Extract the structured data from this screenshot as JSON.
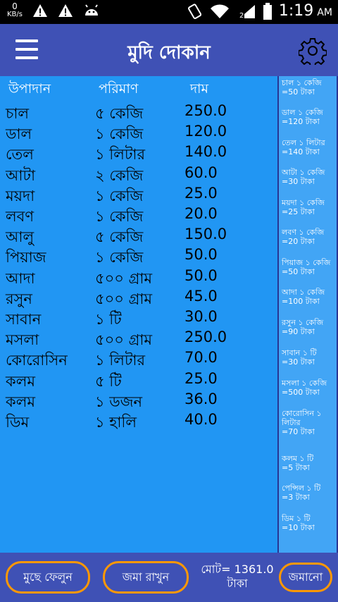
{
  "status_bar": {
    "speed_value": "0",
    "speed_unit": "KB/s",
    "time": "1:19",
    "ampm": "AM"
  },
  "app_bar": {
    "title": "মুদি দোকান"
  },
  "table": {
    "headers": {
      "item": "উপাদান",
      "quantity": "পরিমাণ",
      "price": "দাম"
    },
    "rows": [
      {
        "item": "চাল",
        "quantity": "৫ কেজি",
        "price": "250.0"
      },
      {
        "item": "ডাল",
        "quantity": "১ কেজি",
        "price": "120.0"
      },
      {
        "item": "তেল",
        "quantity": "১ লিটার",
        "price": "140.0"
      },
      {
        "item": "আটা",
        "quantity": "২ কেজি",
        "price": "60.0"
      },
      {
        "item": "ময়দা",
        "quantity": "১ কেজি",
        "price": "25.0"
      },
      {
        "item": "লবণ",
        "quantity": "১ কেজি",
        "price": "20.0"
      },
      {
        "item": "আলু",
        "quantity": "৫ কেজি",
        "price": "150.0"
      },
      {
        "item": "পিয়াজ",
        "quantity": "১ কেজি",
        "price": "50.0"
      },
      {
        "item": "আদা",
        "quantity": "৫০০ গ্রাম",
        "price": "50.0"
      },
      {
        "item": "রসুন",
        "quantity": "৫০০ গ্রাম",
        "price": "45.0"
      },
      {
        "item": "সাবান",
        "quantity": "১ টি",
        "price": "30.0"
      },
      {
        "item": "মসলা",
        "quantity": "৫০০ গ্রাম",
        "price": "250.0"
      },
      {
        "item": "কোরোসিন",
        "quantity": "১ লিটার",
        "price": "70.0"
      },
      {
        "item": "কলম",
        "quantity": "৫ টি",
        "price": "25.0"
      },
      {
        "item": "কলম",
        "quantity": "১ ডজন",
        "price": "36.0"
      },
      {
        "item": "ডিম",
        "quantity": "১ হালি",
        "price": "40.0"
      }
    ]
  },
  "price_list": [
    {
      "line1": "চাল ১ কেজি",
      "line2": "=50 টাকা"
    },
    {
      "line1": "ডাল ১ কেজি",
      "line2": "=120 টাকা"
    },
    {
      "line1": "তেল ১ লিটার",
      "line2": "=140 টাকা"
    },
    {
      "line1": "আটা ১ কেজি",
      "line2": "=30 টাকা"
    },
    {
      "line1": "ময়দা ১ কেজি",
      "line2": "=25 টাকা"
    },
    {
      "line1": "লবণ ১ কেজি",
      "line2": "=20 টাকা"
    },
    {
      "line1": "পিয়াজ ১ কেজি",
      "line2": "=50 টাকা"
    },
    {
      "line1": "আদা ১ কেজি",
      "line2": "=100 টাকা"
    },
    {
      "line1": "রসুন ১ কেজি",
      "line2": "=90 টাকা"
    },
    {
      "line1": "সাবান ১ টি",
      "line2": "=30 টাকা"
    },
    {
      "line1": "মসলা ১ কেজি",
      "line2": "=500 টাকা"
    },
    {
      "line1": "কোরোসিন ১ লিটার",
      "line2": "=70 টাকা"
    },
    {
      "line1": "কলম ১ টি",
      "line2": "=5 টাকা"
    },
    {
      "line1": "পেন্সিল ১ টি",
      "line2": "=3 টাকা"
    },
    {
      "line1": "ডিম ১ টি",
      "line2": "=10 টাকা"
    }
  ],
  "bottom_bar": {
    "clear_label": "মুছে ফেলুন",
    "save_label": "জমা রাখুন",
    "total_line1": "মোট= 1361.0",
    "total_line2": "টাকা",
    "saved_label": "জমানো"
  },
  "colors": {
    "app_bar": "#3f51b5",
    "main_bg": "#2196f3",
    "side_bg": "#42a5f5",
    "button_border": "#ff9800"
  }
}
